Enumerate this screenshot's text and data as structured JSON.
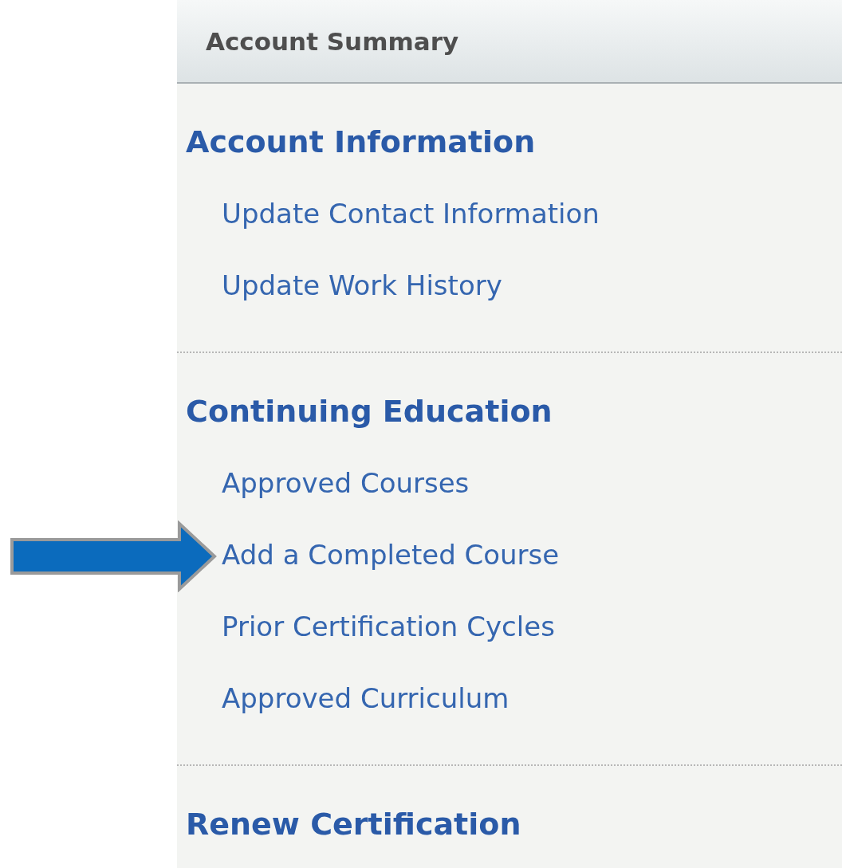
{
  "panel": {
    "title": "Account Summary"
  },
  "sections": [
    {
      "heading": "Account Information",
      "items": [
        {
          "label": "Update Contact Information",
          "pointed": false
        },
        {
          "label": "Update Work History",
          "pointed": false
        }
      ]
    },
    {
      "heading": "Continuing Education",
      "items": [
        {
          "label": "Approved Courses",
          "pointed": false
        },
        {
          "label": "Add a Completed Course",
          "pointed": true
        },
        {
          "label": "Prior Certification Cycles",
          "pointed": false
        },
        {
          "label": "Approved Curriculum",
          "pointed": false
        }
      ]
    },
    {
      "heading": "Renew Certification"
    }
  ]
}
